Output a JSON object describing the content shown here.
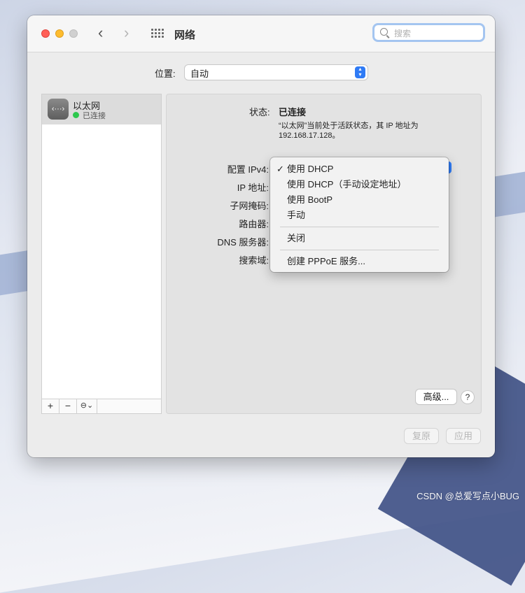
{
  "window": {
    "title": "网络"
  },
  "search": {
    "placeholder": "搜索"
  },
  "location": {
    "label": "位置:",
    "value": "自动"
  },
  "sidebar": {
    "services": [
      {
        "name": "以太网",
        "status": "已连接",
        "status_color": "#2dc84d"
      }
    ],
    "tools": {
      "add": "+",
      "remove": "−",
      "action": "⊖⌄"
    }
  },
  "detail": {
    "status_label": "状态:",
    "status_value": "已连接",
    "status_desc": "“以太网”当前处于活跃状态，其 IP 地址为 192.168.17.128。",
    "field_labels": {
      "ipv4": "配置 IPv4:",
      "ip": "IP 地址:",
      "subnet": "子网掩码:",
      "router": "路由器:",
      "dns": "DNS 服务器:",
      "search_domain": "搜索域:"
    }
  },
  "ipv4_menu": {
    "items": [
      {
        "label": "使用 DHCP",
        "checked": true
      },
      {
        "label": "使用 DHCP（手动设定地址）",
        "checked": false
      },
      {
        "label": "使用 BootP",
        "checked": false
      },
      {
        "label": "手动",
        "checked": false
      },
      {
        "label": "关闭",
        "checked": false
      },
      {
        "label": "创建 PPPoE 服务...",
        "checked": false
      }
    ],
    "check_glyph": "✓"
  },
  "buttons": {
    "advanced": "高级...",
    "help": "?",
    "revert": "复原",
    "apply": "应用"
  },
  "watermark": "CSDN @总爱写点小BUG",
  "colors": {
    "accent": "#2f7bf5",
    "connected": "#2dc84d"
  }
}
